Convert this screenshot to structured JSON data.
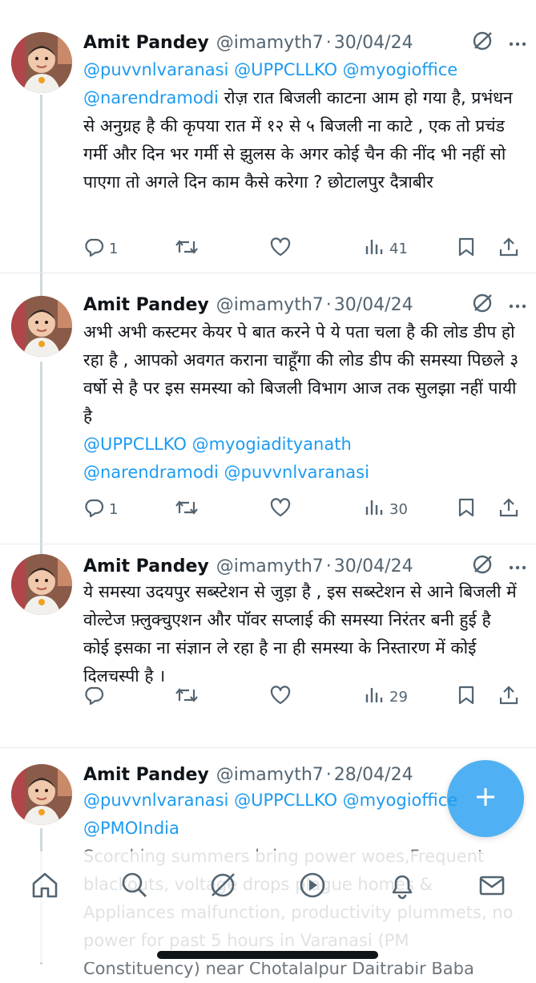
{
  "tweets": [
    {
      "name": "Amit Pandey",
      "handle": "@imamyth7",
      "separator": "·",
      "date": "30/04/24",
      "text_mentions_line1": "@puvvnlvaranasi @UPPCLLKO @myogioffice",
      "text_mention_line2": "@narendramodi",
      "text_body": " रोज़ रात बिजली काटना आम हो गया है, प्रभंधन से अनुग्रह है की कृपया रात में १२ से ५ बिजली ना काटे , एक तो प्रचंड गर्मी और दिन भर गर्मी से झुलस के अगर कोई चैन की नींद भी नहीं सो पाएगा तो अगले दिन काम कैसे करेगा ? छोटालपुर दैत्राबीर",
      "replies": "1",
      "retweets": "",
      "likes": "",
      "views": "41"
    },
    {
      "name": "Amit Pandey",
      "handle": "@imamyth7",
      "separator": "·",
      "date": "30/04/24",
      "text_body": "अभी अभी कस्टमर केयर पे बात करने पे ये पता चला है की लोड डीप हो रहा है , आपको अवगत कराना चाहूँगा की लोड डीप की समस्या पिछले ३ वर्षो से है पर इस समस्या को बिजली विभाग आज तक सुलझा नहीं पायी है",
      "text_mentions_line1": "@UPPCLLKO @myogiadityanath",
      "text_mentions_line2": "@narendramodi @puvvnlvaranasi",
      "replies": "1",
      "retweets": "",
      "likes": "",
      "views": "30"
    },
    {
      "name": "Amit Pandey",
      "handle": "@imamyth7",
      "separator": "·",
      "date": "30/04/24",
      "text_body": "ये समस्या उदयपुर सब्स्टेशन से जुड़ा है , इस सब्स्टेशन से आने बिजली में वोल्टेज फ़्लुक्चुएशन और पॉवर सप्लाई की समस्या निरंतर बनी हुई है कोई इसका ना संज्ञान ले रहा है ना ही समस्या के निस्तारण में कोई दिलचस्पी है ।",
      "replies": "",
      "retweets": "",
      "likes": "",
      "views": "29"
    },
    {
      "name": "Amit Pandey",
      "handle": "@imamyth7",
      "separator": "·",
      "date": "28/04/24",
      "text_mentions_line1": "@puvvnlvaranasi @UPPCLLKO @myogioffice",
      "text_mentions_line2": "@PMOIndia",
      "text_body": "Scorching summers bring power woes,Frequent blackouts, voltage drops plague homes & Appliances malfunction, productivity plummets, no power for past 5 hours in Varanasi (PM Constituency) near Chotalalpur Daitrabir Baba"
    }
  ],
  "icons": {
    "grok": "grok-icon",
    "more": "more-icon",
    "reply": "reply-icon",
    "retweet": "retweet-icon",
    "like": "heart-icon",
    "views": "views-icon",
    "bookmark": "bookmark-icon",
    "share": "share-icon",
    "compose": "compose-icon",
    "home": "home-icon",
    "search": "search-icon",
    "communities": "grok-nav-icon",
    "spaces": "play-icon",
    "notifications": "bell-icon",
    "messages": "mail-icon"
  },
  "colors": {
    "accent": "#1d9bf0",
    "text": "#0f1419",
    "muted": "#536471",
    "thread_line": "#cfd9de"
  }
}
